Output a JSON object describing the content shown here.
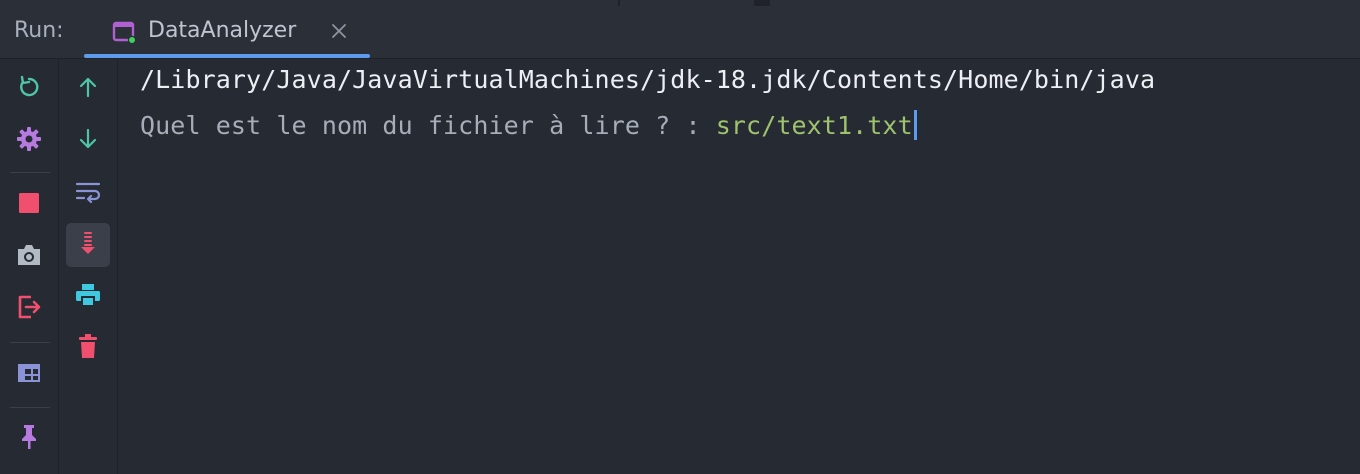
{
  "header": {
    "run_label": "Run:",
    "tab": {
      "title": "DataAnalyzer",
      "icon": "console-window-icon",
      "close_icon": "close-icon"
    }
  },
  "left_toolbar": {
    "items": [
      {
        "name": "rerun-icon",
        "color": "#4fc4a6"
      },
      {
        "name": "gear-icon",
        "color": "#b77be0"
      },
      {
        "name": "stop-icon",
        "color": "#f0506e"
      },
      {
        "name": "camera-icon",
        "color": "#b4bac4"
      },
      {
        "name": "exit-icon",
        "color": "#f0506e"
      },
      {
        "name": "layout-icon",
        "color": "#8a93d6"
      },
      {
        "name": "pin-icon",
        "color": "#b77be0"
      }
    ]
  },
  "second_toolbar": {
    "items": [
      {
        "name": "arrow-up-icon",
        "color": "#4fc4a6"
      },
      {
        "name": "arrow-down-icon",
        "color": "#4fc4a6"
      },
      {
        "name": "soft-wrap-icon",
        "color": "#8a93d6"
      },
      {
        "name": "scroll-to-end-icon",
        "color": "#f0506e",
        "active": true
      },
      {
        "name": "print-icon",
        "color": "#3fc8e0"
      },
      {
        "name": "trash-icon",
        "color": "#f0506e"
      }
    ]
  },
  "console": {
    "line1": "/Library/Java/JavaVirtualMachines/jdk-18.jdk/Contents/Home/bin/java",
    "line2_prompt": "Quel est le nom du fichier à lire ? : ",
    "line2_input": "src/text1.txt"
  },
  "colors": {
    "accent": "#5d9cec",
    "background": "#262a33",
    "input_text": "#9ec26d"
  }
}
